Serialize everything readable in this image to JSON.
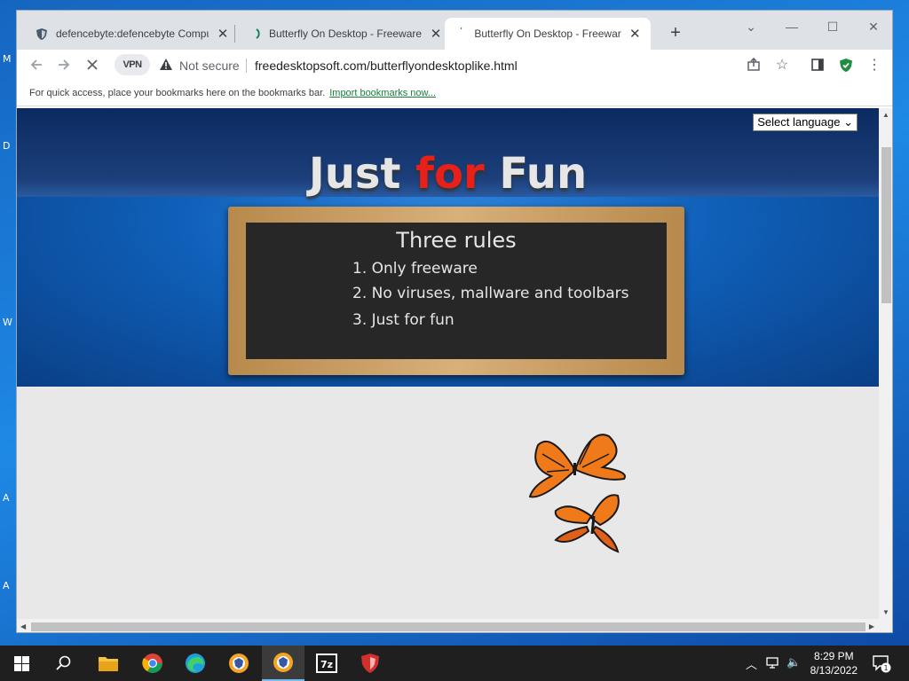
{
  "desktop": {
    "edge_letters": [
      "M",
      "D",
      "W",
      "A",
      "A"
    ]
  },
  "tabs": [
    {
      "title": "defencebyte:defencebyte Compu",
      "icon": "shield-icon"
    },
    {
      "title": "Butterfly On Desktop - Freeware",
      "icon": "loading-icon"
    },
    {
      "title": "Butterfly On Desktop - Freeware",
      "icon": "loading-icon",
      "active": true
    }
  ],
  "toolbar": {
    "vpn_label": "VPN",
    "security_label": "Not secure",
    "url": "freedesktopsoft.com/butterflyondesktoplike.html"
  },
  "bookmarks_bar": {
    "message": "For quick access, place your bookmarks here on the bookmarks bar.",
    "import_link": "Import bookmarks now..."
  },
  "page": {
    "language_select": "Select language",
    "hero_title_part1": "Just ",
    "hero_title_part2": "for",
    "hero_title_part3": " Fun",
    "board_title": "Three rules",
    "rules": [
      "1. Only freeware",
      "2. No viruses, mallware and toolbars",
      "3. Just for fun"
    ]
  },
  "taskbar": {
    "time": "8:29 PM",
    "date": "8/13/2022",
    "notification_count": "1"
  },
  "colors": {
    "accent_red": "#e8201a",
    "hero_blue": "#0f5fb8",
    "board_dark": "#272727"
  }
}
